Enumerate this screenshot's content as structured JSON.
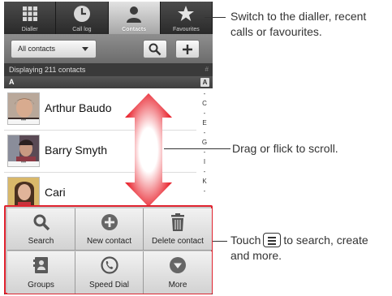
{
  "tabs": [
    {
      "label": "Dialler",
      "icon": "dialpad-icon",
      "active": false
    },
    {
      "label": "Call log",
      "icon": "clock-icon",
      "active": false
    },
    {
      "label": "Contacts",
      "icon": "person-icon",
      "active": true
    },
    {
      "label": "Favourites",
      "icon": "star-icon",
      "active": false
    }
  ],
  "toolbar": {
    "filter_label": "All contacts"
  },
  "list": {
    "count_label": "Displaying 211 contacts",
    "hash": "#",
    "section_letter": "A",
    "section_index": "A",
    "contacts": [
      {
        "name": "Arthur Baudo"
      },
      {
        "name": "Barry Smyth"
      },
      {
        "name": "Cari"
      }
    ],
    "alpha_index": [
      "-",
      "C",
      "-",
      "E",
      "-",
      "G",
      "-",
      "I",
      "-",
      "K",
      "-"
    ]
  },
  "menu": {
    "items": [
      {
        "label": "Search",
        "icon": "search-icon"
      },
      {
        "label": "New contact",
        "icon": "add-contact-icon"
      },
      {
        "label": "Delete contact",
        "icon": "trash-icon"
      },
      {
        "label": "Groups",
        "icon": "groups-icon"
      },
      {
        "label": "Speed Dial",
        "icon": "speed-dial-icon"
      },
      {
        "label": "More",
        "icon": "more-icon"
      }
    ]
  },
  "callouts": {
    "tabs_line1": "Switch to the dialler, recent",
    "tabs_line2": "calls or favourites.",
    "scroll": "Drag or flick to scroll.",
    "menu_before": "Touch",
    "menu_after": "to search, create",
    "menu_line2": "and more."
  },
  "colors": {
    "highlight": "#e0232f",
    "arrow_red": "#e8202a"
  }
}
